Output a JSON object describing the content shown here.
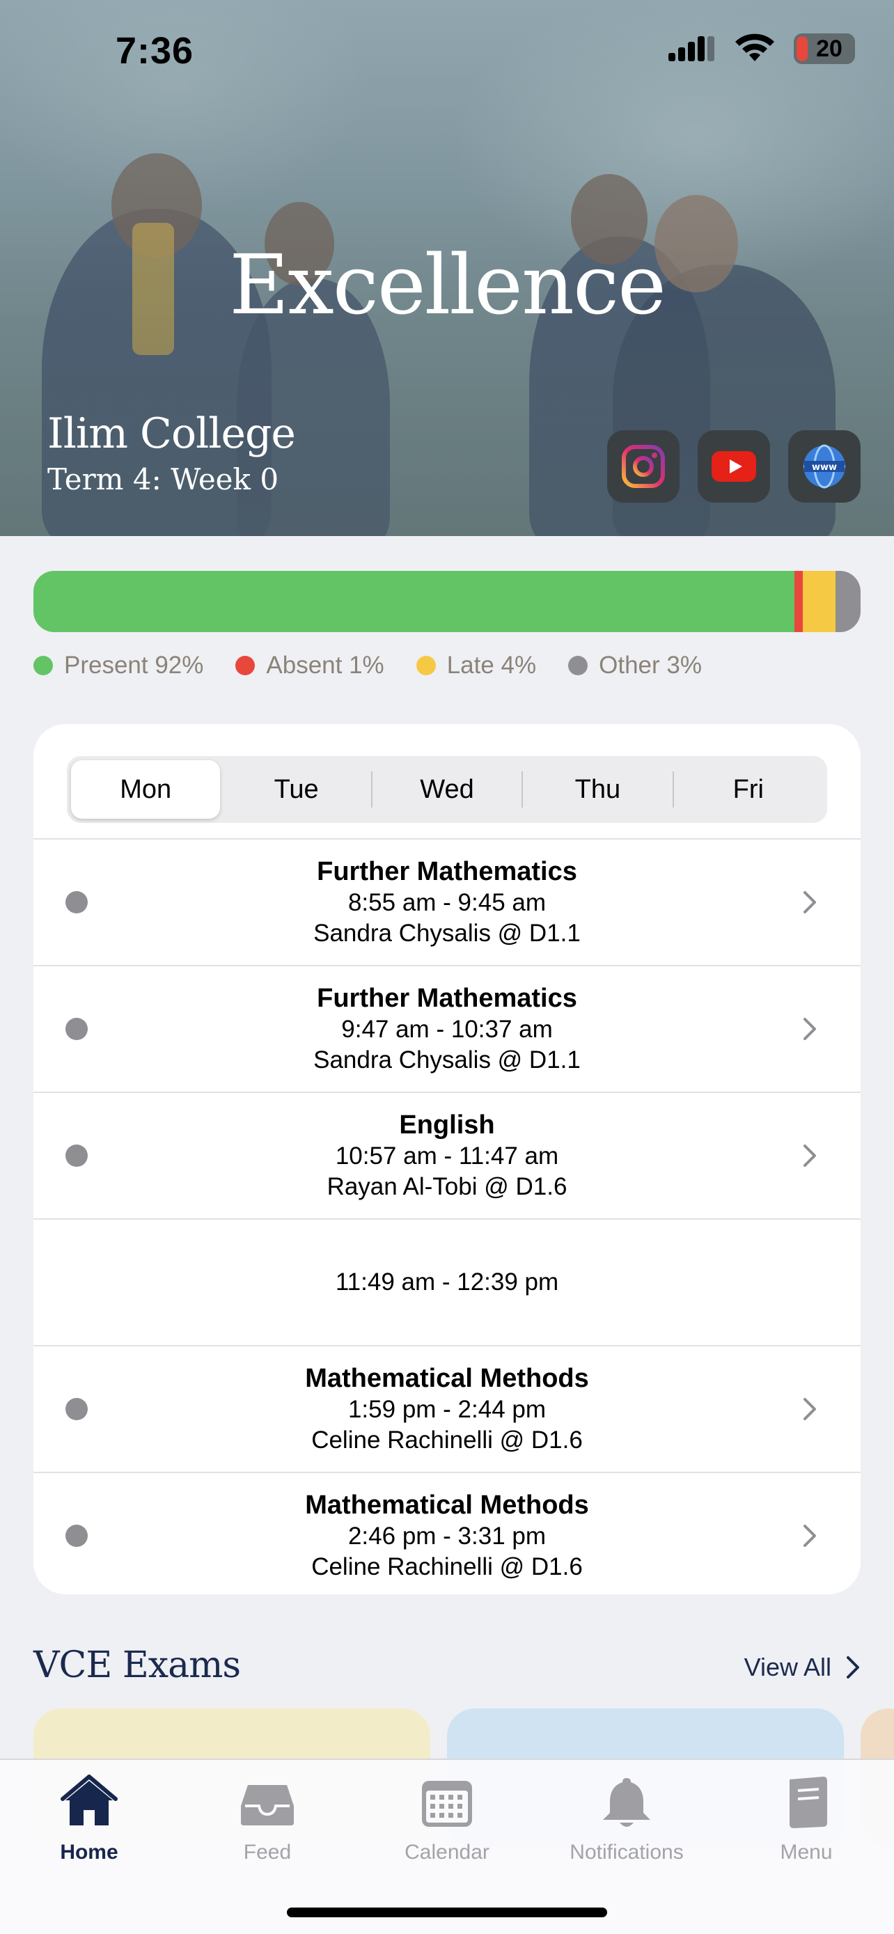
{
  "status": {
    "time": "7:36",
    "battery": "20"
  },
  "hero": {
    "title": "Excellence",
    "school": "Ilim College",
    "term": "Term 4: Week 0"
  },
  "social": [
    "instagram-icon",
    "youtube-icon",
    "website-icon"
  ],
  "attendance": [
    {
      "label": "Present 92%",
      "fraction": 0.92,
      "color": "#63c466"
    },
    {
      "label": "Absent 1%",
      "fraction": 0.01,
      "color": "#e8473c"
    },
    {
      "label": "Late 4%",
      "fraction": 0.04,
      "color": "#f6c944"
    },
    {
      "label": "Other 3%",
      "fraction": 0.03,
      "color": "#8e8e93"
    }
  ],
  "days": [
    "Mon",
    "Tue",
    "Wed",
    "Thu",
    "Fri"
  ],
  "selected_day": "Mon",
  "classes": [
    {
      "subject": "Further Mathematics",
      "time": "8:55 am - 9:45 am",
      "teacher": "Sandra Chysalis @ D1.1"
    },
    {
      "subject": "Further Mathematics",
      "time": "9:47 am - 10:37 am",
      "teacher": "Sandra Chysalis @ D1.1"
    },
    {
      "subject": "English",
      "time": "10:57 am - 11:47 am",
      "teacher": "Rayan Al-Tobi @ D1.6"
    },
    {
      "subject": "",
      "time": "11:49 am - 12:39 pm",
      "teacher": ""
    },
    {
      "subject": "Mathematical Methods",
      "time": "1:59 pm - 2:44 pm",
      "teacher": "Celine Rachinelli @ D1.6"
    },
    {
      "subject": "Mathematical Methods",
      "time": "2:46 pm - 3:31 pm",
      "teacher": "Celine Rachinelli @ D1.6"
    }
  ],
  "exams": {
    "title": "VCE Exams",
    "view_all": "View All"
  },
  "tabs": [
    {
      "label": "Home",
      "icon": "home-icon",
      "active": true
    },
    {
      "label": "Feed",
      "icon": "inbox-icon",
      "active": false
    },
    {
      "label": "Calendar",
      "icon": "calendar-icon",
      "active": false
    },
    {
      "label": "Notifications",
      "icon": "bell-icon",
      "active": false
    },
    {
      "label": "Menu",
      "icon": "menu-book-icon",
      "active": false
    }
  ]
}
